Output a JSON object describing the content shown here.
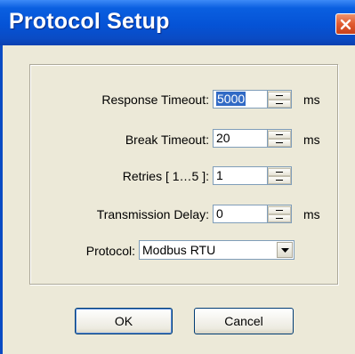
{
  "window": {
    "title": "Protocol Setup"
  },
  "fields": {
    "response_timeout": {
      "label": "Response Timeout:",
      "value": "5000",
      "unit": "ms"
    },
    "break_timeout": {
      "label": "Break Timeout:",
      "value": "20",
      "unit": "ms"
    },
    "retries": {
      "label": "Retries [ 1…5 ]:",
      "value": "1"
    },
    "transmission_delay": {
      "label": "Transmission Delay:",
      "value": "0",
      "unit": "ms"
    },
    "protocol": {
      "label": "Protocol:",
      "value": "Modbus RTU"
    }
  },
  "buttons": {
    "ok": "OK",
    "cancel": "Cancel"
  },
  "colors": {
    "titlebar": "#0553d6",
    "close": "#e05a30",
    "dialog_bg": "#ece9d8",
    "selection": "#316ac5"
  },
  "icons": [
    "close-icon",
    "spin-up-icon",
    "spin-down-icon",
    "dropdown-arrow-icon"
  ]
}
